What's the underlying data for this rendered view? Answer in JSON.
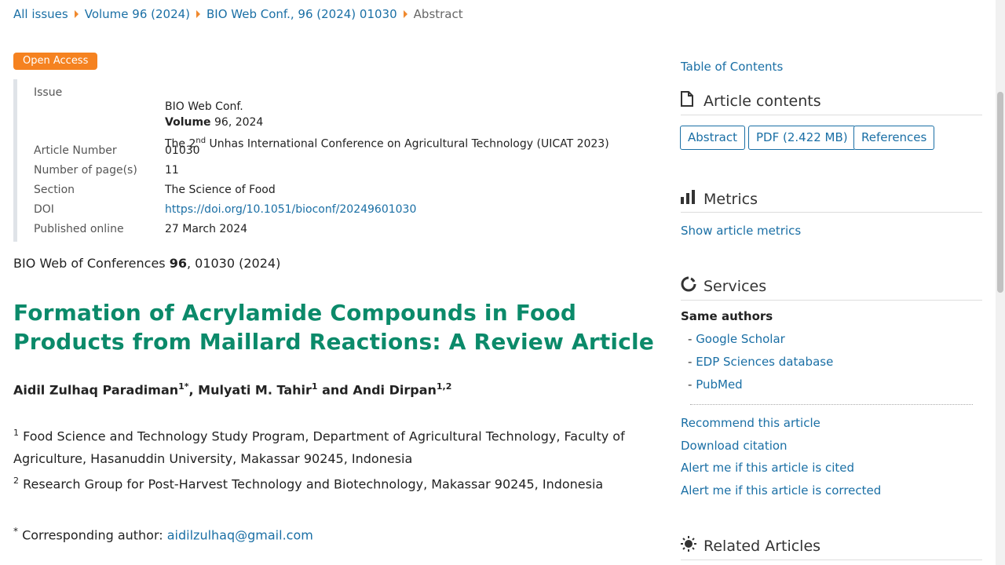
{
  "breadcrumb": {
    "items": [
      "All issues",
      "Volume 96 (2024)",
      "BIO Web Conf., 96 (2024) 01030",
      "Abstract"
    ]
  },
  "badge": "Open Access",
  "info": {
    "issue_label": "Issue",
    "issue_journal": "BIO Web Conf.",
    "issue_volume_label": "Volume",
    "issue_volume_value": "96, 2024",
    "issue_conf_pre": "The 2",
    "issue_conf_sup": "nd",
    "issue_conf_post": " Unhas International Conference on Agricultural Technology (UICAT 2023)",
    "article_number_label": "Article Number",
    "article_number": "01030",
    "pages_label": "Number of page(s)",
    "pages": "11",
    "section_label": "Section",
    "section": "The Science of Food",
    "doi_label": "DOI",
    "doi": "https://doi.org/10.1051/bioconf/20249601030",
    "published_label": "Published online",
    "published": "27 March 2024"
  },
  "citation": {
    "pre": "BIO Web of Conferences ",
    "vol": "96",
    "post": ", 01030 (2024)"
  },
  "title": "Formation of Acrylamide Compounds in Food Products from Maillard Reactions: A Review Article",
  "authors": {
    "a1": "Aidil Zulhaq Paradiman",
    "a1_sup": "1*",
    "a2": ", Mulyati M. Tahir",
    "a2_sup": "1",
    "a3": " and Andi Dirpan",
    "a3_sup": "1,2"
  },
  "affiliations": {
    "aff1_sup": "1",
    "aff1": " Food Science and Technology Study Program, Department of Agricultural Technology, Faculty of Agriculture, Hasanuddin University, Makassar 90245, Indonesia",
    "aff2_sup": "2",
    "aff2": " Research Group for Post-Harvest Technology and Biotechnology, Makassar 90245, Indonesia"
  },
  "corresponding": {
    "sup": "*",
    "label": " Corresponding author: ",
    "email": "aidilzulhaq@gmail.com"
  },
  "sidebar": {
    "toc": "Table of Contents",
    "article_contents": "Article contents",
    "btn_abstract": "Abstract",
    "btn_pdf": "PDF (2.422 MB)",
    "btn_references": "References",
    "metrics": "Metrics",
    "show_metrics": "Show article metrics",
    "services": "Services",
    "same_authors": "Same authors",
    "google_scholar": "Google Scholar",
    "edp": "EDP Sciences database",
    "pubmed": "PubMed",
    "recommend": "Recommend this article",
    "download": "Download citation",
    "alert_cited": "Alert me if this article is cited",
    "alert_corrected": "Alert me if this article is corrected",
    "related": "Related Articles"
  },
  "colors": {
    "title": "#0b8a6a",
    "link": "#1a6fa5",
    "badge": "#f58220",
    "breadcrumb_arrow": "#f0892e"
  }
}
